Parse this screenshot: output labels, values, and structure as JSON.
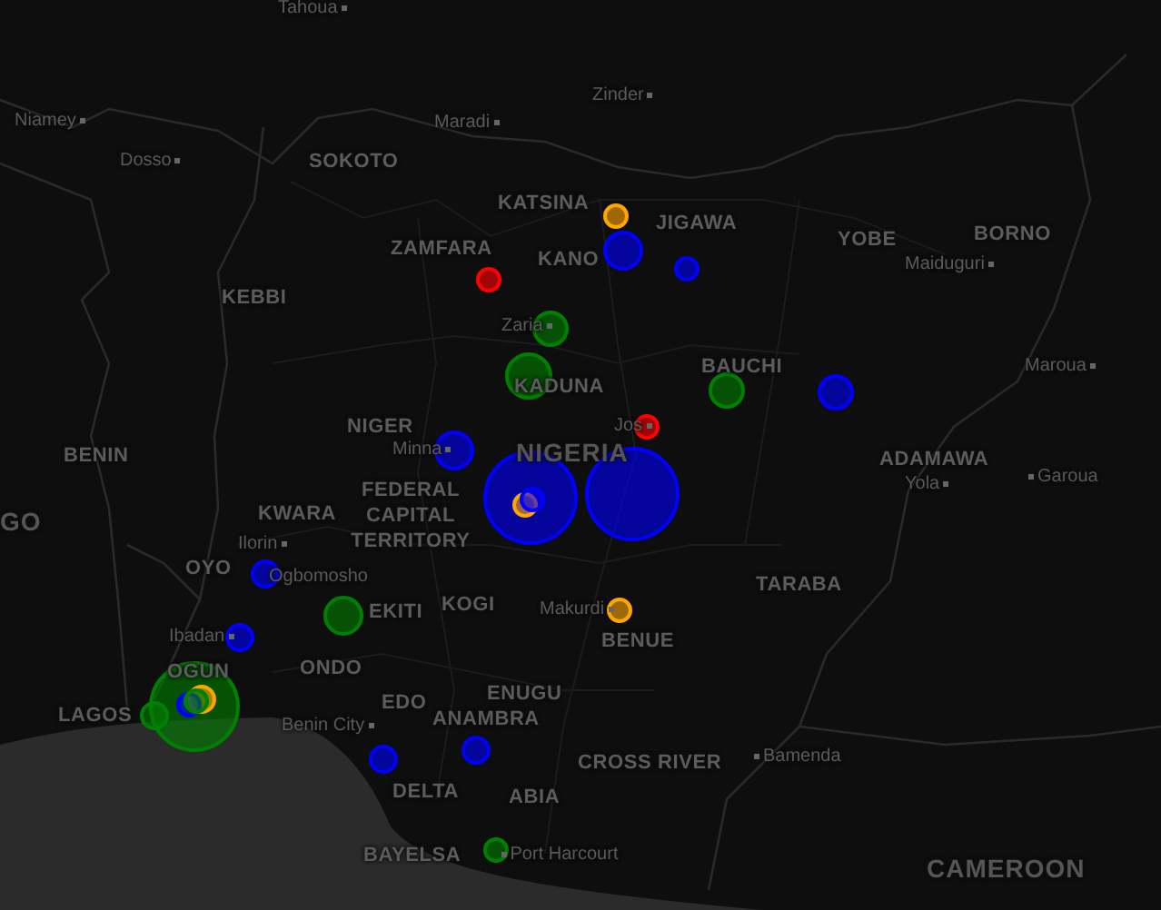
{
  "map": {
    "labels": [
      {
        "text": "Tahoua",
        "kind": "city"
      },
      {
        "text": "Niamey",
        "kind": "city"
      },
      {
        "text": "Dosso",
        "kind": "city"
      },
      {
        "text": "SOKOTO",
        "kind": "region"
      },
      {
        "text": "KEBBI",
        "kind": "region"
      },
      {
        "text": "NIGER",
        "kind": "region"
      },
      {
        "text": "BENIN",
        "kind": "region"
      },
      {
        "text": "Maradi",
        "kind": "city"
      },
      {
        "text": "Zinder",
        "kind": "city"
      },
      {
        "text": "KATSINA",
        "kind": "region"
      },
      {
        "text": "ZAMFARA",
        "kind": "region"
      },
      {
        "text": "JIGAWA",
        "kind": "region"
      },
      {
        "text": "KANO",
        "kind": "region"
      },
      {
        "text": "Zaria",
        "kind": "city"
      },
      {
        "text": "KADUNA",
        "kind": "region"
      },
      {
        "text": "BAUCHI",
        "kind": "region"
      },
      {
        "text": "Jos",
        "kind": "city"
      },
      {
        "text": "Minna",
        "kind": "city"
      },
      {
        "text": "NIGERIA",
        "kind": "country"
      },
      {
        "text": "YOBE",
        "kind": "region"
      },
      {
        "text": "BORNO",
        "kind": "region"
      },
      {
        "text": "Maiduguri",
        "kind": "city"
      },
      {
        "text": "Maroua",
        "kind": "city"
      },
      {
        "text": "ADAMAWA",
        "kind": "region"
      },
      {
        "text": "Yola",
        "kind": "city"
      },
      {
        "text": "Garoua",
        "kind": "city"
      },
      {
        "text": "TARABA",
        "kind": "region"
      },
      {
        "text": "Bamenda",
        "kind": "city"
      },
      {
        "text": "CAMEROON",
        "kind": "country"
      },
      {
        "text": "GO",
        "kind": "country"
      },
      {
        "text": "KWARA",
        "kind": "region"
      },
      {
        "text": "Ilorin",
        "kind": "city"
      },
      {
        "text": "OYO",
        "kind": "region"
      },
      {
        "text": "Ogbomosho",
        "kind": "city"
      },
      {
        "text": "EKITI",
        "kind": "region"
      },
      {
        "text": "Ibadan",
        "kind": "city"
      },
      {
        "text": "ONDO",
        "kind": "region"
      },
      {
        "text": "OGUN",
        "kind": "region"
      },
      {
        "text": "LAGOS",
        "kind": "region"
      },
      {
        "text": "Benin City",
        "kind": "city"
      },
      {
        "text": "FEDERAL CAPITAL TERRITORY",
        "kind": "region"
      },
      {
        "text": "KOGI",
        "kind": "region"
      },
      {
        "text": "Makurdi",
        "kind": "city"
      },
      {
        "text": "BENUE",
        "kind": "region"
      },
      {
        "text": "EDO",
        "kind": "region"
      },
      {
        "text": "ENUGU",
        "kind": "region"
      },
      {
        "text": "ANAMBRA",
        "kind": "region"
      },
      {
        "text": "CROSS RIVER",
        "kind": "region"
      },
      {
        "text": "DELTA",
        "kind": "region"
      },
      {
        "text": "ABIA",
        "kind": "region"
      },
      {
        "text": "BAYELSA",
        "kind": "region"
      },
      {
        "text": "Port Harcourt",
        "kind": "city"
      }
    ],
    "markers": [
      {
        "color": "#ffa500"
      },
      {
        "color": "#0000ff"
      },
      {
        "color": "#ff0000"
      },
      {
        "color": "#0000ff"
      },
      {
        "color": "#008000"
      },
      {
        "color": "#008000"
      },
      {
        "color": "#008000"
      },
      {
        "color": "#0000ff"
      },
      {
        "color": "#ff0000"
      },
      {
        "color": "#0000ff"
      },
      {
        "color": "#0000ff"
      },
      {
        "color": "#0000ff"
      },
      {
        "color": "#ffa500"
      },
      {
        "color": "#0000ff"
      },
      {
        "color": "#ffa500"
      },
      {
        "color": "#0000ff"
      },
      {
        "color": "#008000"
      },
      {
        "color": "#0000ff"
      },
      {
        "color": "#008000"
      },
      {
        "color": "#008000"
      },
      {
        "color": "#ffa500"
      },
      {
        "color": "#0000ff"
      },
      {
        "color": "#008000"
      },
      {
        "color": "#0000ff"
      },
      {
        "color": "#0000ff"
      },
      {
        "color": "#008000"
      }
    ]
  }
}
